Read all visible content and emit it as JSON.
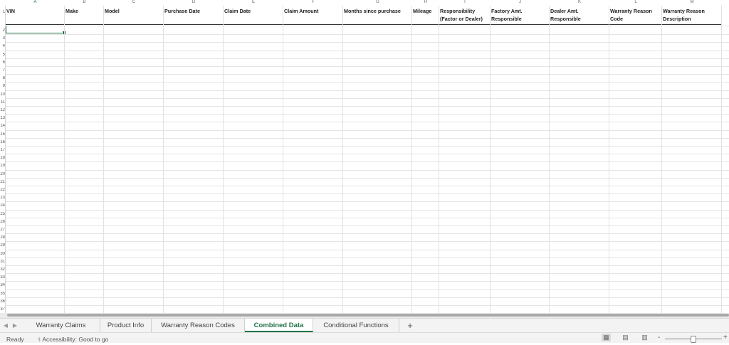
{
  "columns": [
    "A",
    "B",
    "C",
    "D",
    "E",
    "F",
    "G",
    "H",
    "I",
    "J",
    "K",
    "L",
    "M"
  ],
  "active_column": "A",
  "headers": [
    "VIN",
    "Make",
    "Model",
    "Purchase Date",
    "Claim Date",
    "Claim Amount",
    "Months since purchase",
    "Mileage",
    "Responsibility\n(Factor or Dealer)",
    "Factory Amt.\nResponsible",
    "Dealer Amt.\nResponsible",
    "Warranty Reason\nCode",
    "Warranty Reason\nDescription"
  ],
  "row_numbers": [
    "1",
    "2",
    "3",
    "4",
    "5",
    "6",
    "7",
    "8",
    "9",
    "10",
    "11",
    "12",
    "13",
    "14",
    "15",
    "16",
    "17",
    "18",
    "19",
    "20",
    "21",
    "22",
    "23",
    "24",
    "25",
    "26",
    "27",
    "28",
    "29",
    "30",
    "31",
    "32",
    "33",
    "34",
    "35",
    "36",
    "37"
  ],
  "sheet_tabs": [
    "Warranty Claims",
    "Product Info",
    "Warranty Reason Codes",
    "Combined Data",
    "Conditional Functions"
  ],
  "active_tab": "Combined Data",
  "add_sheet_label": "+",
  "nav_prev": "◀",
  "nav_next": "▶",
  "status": {
    "ready": "Ready",
    "accessibility": "Accessibility: Good to go"
  },
  "view_buttons": [
    "normal-view",
    "page-layout-view",
    "page-break-view"
  ],
  "zoom": {
    "minus": "-",
    "plus": "+"
  },
  "colors": {
    "accent": "#217346",
    "gridline": "#e1e1e1"
  }
}
